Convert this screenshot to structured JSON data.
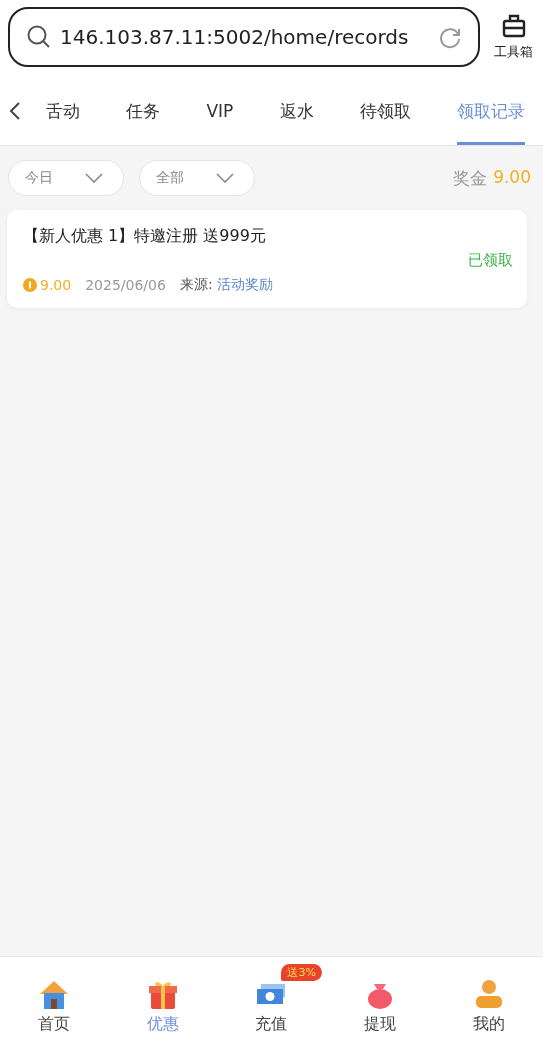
{
  "address_bar": {
    "url": "146.103.87.11:5002/home/records",
    "tool_label": "工具箱"
  },
  "tabs": [
    {
      "label": "舌动",
      "selected": false
    },
    {
      "label": "任务",
      "selected": false
    },
    {
      "label": "VIP",
      "selected": false
    },
    {
      "label": "返水",
      "selected": false
    },
    {
      "label": "待领取",
      "selected": false
    },
    {
      "label": "领取记录",
      "selected": true
    }
  ],
  "filters": [
    {
      "value": "今日"
    },
    {
      "value": "全部"
    }
  ],
  "bonus": {
    "label": "奖金",
    "amount": "9.00"
  },
  "records": [
    {
      "title": "【新人优惠 1】特邀注册 送999元",
      "status": "已领取",
      "amount": "9.00",
      "date": "2025/06/06",
      "source_label": "来源:",
      "source": "活动奖励"
    }
  ],
  "bottom_nav": [
    {
      "label": "首页",
      "selected": false
    },
    {
      "label": "优惠",
      "selected": true
    },
    {
      "label": "充值",
      "selected": false,
      "badge": "送3%"
    },
    {
      "label": "提现",
      "selected": false
    },
    {
      "label": "我的",
      "selected": false
    }
  ]
}
